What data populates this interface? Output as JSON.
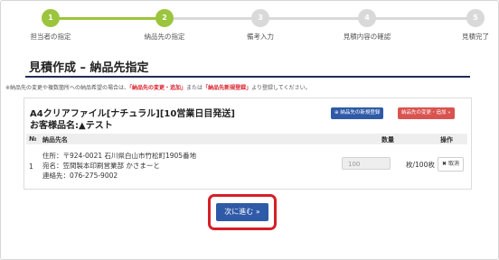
{
  "stepper": {
    "steps": [
      {
        "number": "1",
        "label": "担当者の指定",
        "done": true
      },
      {
        "number": "2",
        "label": "納品先の指定",
        "done": true
      },
      {
        "number": "3",
        "label": "備考入力",
        "done": false
      },
      {
        "number": "4",
        "label": "見積内容の確認",
        "done": false
      },
      {
        "number": "5",
        "label": "見積完了",
        "done": false
      }
    ]
  },
  "page": {
    "title": "見積作成 – 納品先指定",
    "notice_pre": "※納品先の変更や複数箇所への納品希望の場合は、",
    "notice_link1": "「納品先の変更・追加」",
    "notice_mid": "または",
    "notice_link2": "「納品先新規登録」",
    "notice_post": "より登録してください。"
  },
  "panel": {
    "product_name": "A4クリアファイル[ナチュラル][10営業日目発送]",
    "customer_label": "お客様品名:",
    "customer_value": "▲テスト",
    "new_delivery_button": "納品先の新規登録",
    "change_delivery_button": "納品先の変更・追加 »",
    "table": {
      "col_no": "№",
      "col_destination": "納品先名",
      "col_quantity": "数量",
      "col_action": "操作"
    },
    "row": {
      "no": "1",
      "address": "住所：〒924-0021 石川県白山市竹松町1905番地",
      "name": "宛名：笠間製本印刷営業部 かさまーと",
      "phone": "連絡先：076-275-9002",
      "quantity": "100",
      "unit": "枚/100枚",
      "cancel_label": "取消"
    }
  },
  "next_button": "次に進む »",
  "colors": {
    "step_done": "#9bc53d",
    "step_todo": "#d9d9d9",
    "primary": "#2f5aa8",
    "danger": "#d9534f",
    "highlight": "#d51f27"
  }
}
